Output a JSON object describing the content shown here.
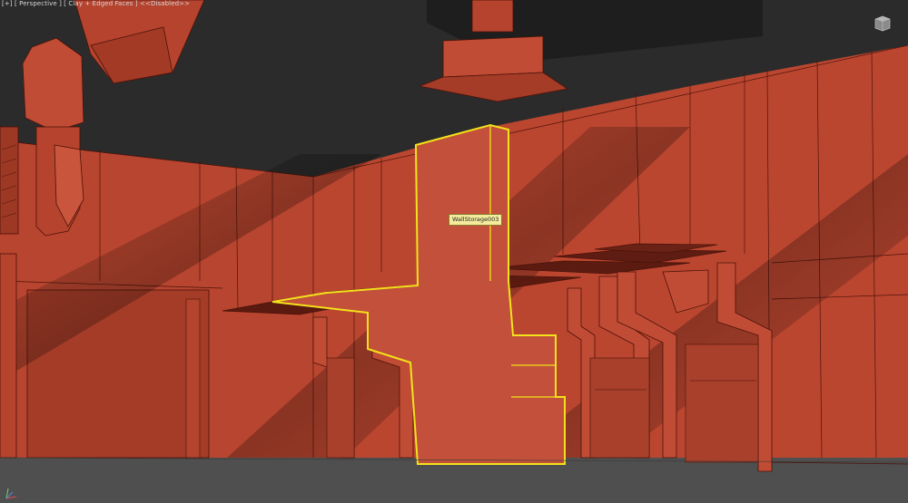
{
  "viewport": {
    "labels": [
      {
        "text": "[+]",
        "name": "viewport-menu-plus"
      },
      {
        "text": " [ Perspective ]",
        "name": "viewport-menu-view"
      },
      {
        "text": " [ Clay + Edged Faces ]",
        "name": "viewport-menu-shading"
      },
      {
        "text": " <<Disabled>>",
        "name": "viewport-menu-disabled"
      }
    ],
    "tooltip": "WallStorage003",
    "selection_color": "#f2e21a",
    "model_color": "#b5432e",
    "background_color": "#2b2b2b",
    "floor_color": "#4f4f4f",
    "viewcube_icon": "viewcube-icon",
    "axis_icon": "axis-tripod-icon"
  }
}
